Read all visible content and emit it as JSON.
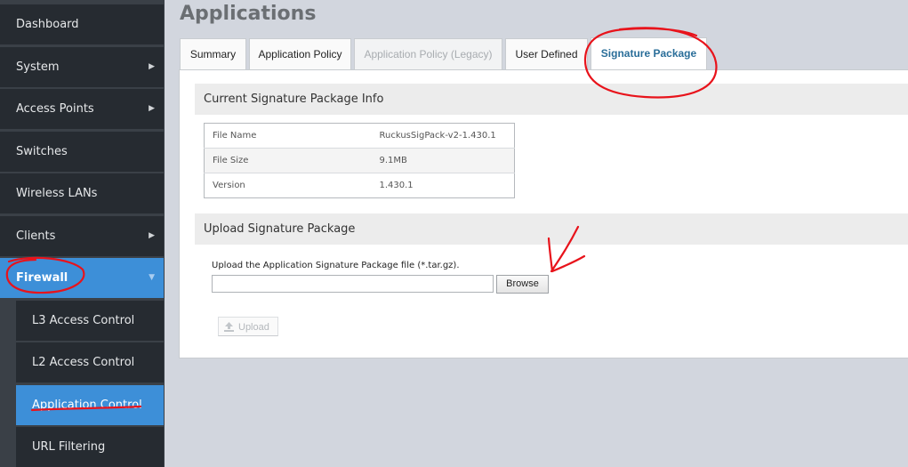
{
  "sidebar": {
    "items": [
      {
        "label": "Dashboard",
        "has_arrow": false
      },
      {
        "label": "System",
        "has_arrow": true
      },
      {
        "label": "Access Points",
        "has_arrow": true
      },
      {
        "label": "Switches",
        "has_arrow": false
      },
      {
        "label": "Wireless LANs",
        "has_arrow": false
      },
      {
        "label": "Clients",
        "has_arrow": true
      },
      {
        "label": "Firewall",
        "has_arrow": true,
        "expanded": true
      }
    ],
    "subitems": [
      {
        "label": "L3 Access Control"
      },
      {
        "label": "L2 Access Control"
      },
      {
        "label": "Application Control",
        "active": true
      },
      {
        "label": "URL Filtering"
      }
    ],
    "arrow_glyph": "▶",
    "expanded_arrow_glyph": "▼"
  },
  "page": {
    "title": "Applications"
  },
  "tabs": [
    {
      "label": "Summary"
    },
    {
      "label": "Application Policy"
    },
    {
      "label": "Application Policy (Legacy)",
      "disabled": true
    },
    {
      "label": "User Defined"
    },
    {
      "label": "Signature Package",
      "active": true
    }
  ],
  "current_info": {
    "title": "Current Signature Package Info",
    "rows": [
      {
        "key": "File Name",
        "value": "RuckusSigPack-v2-1.430.1"
      },
      {
        "key": "File Size",
        "value": "9.1MB"
      },
      {
        "key": "Version",
        "value": "1.430.1"
      }
    ]
  },
  "upload": {
    "title": "Upload Signature Package",
    "label": "Upload the Application Signature Package file (*.tar.gz).",
    "file_value": "",
    "browse_label": "Browse",
    "upload_label": "Upload"
  },
  "colors": {
    "sidebar_bg": "#262b31",
    "active_blue": "#3d8fd8",
    "annotation_red": "#e8131b",
    "tab_active_text": "#2a6e99"
  }
}
